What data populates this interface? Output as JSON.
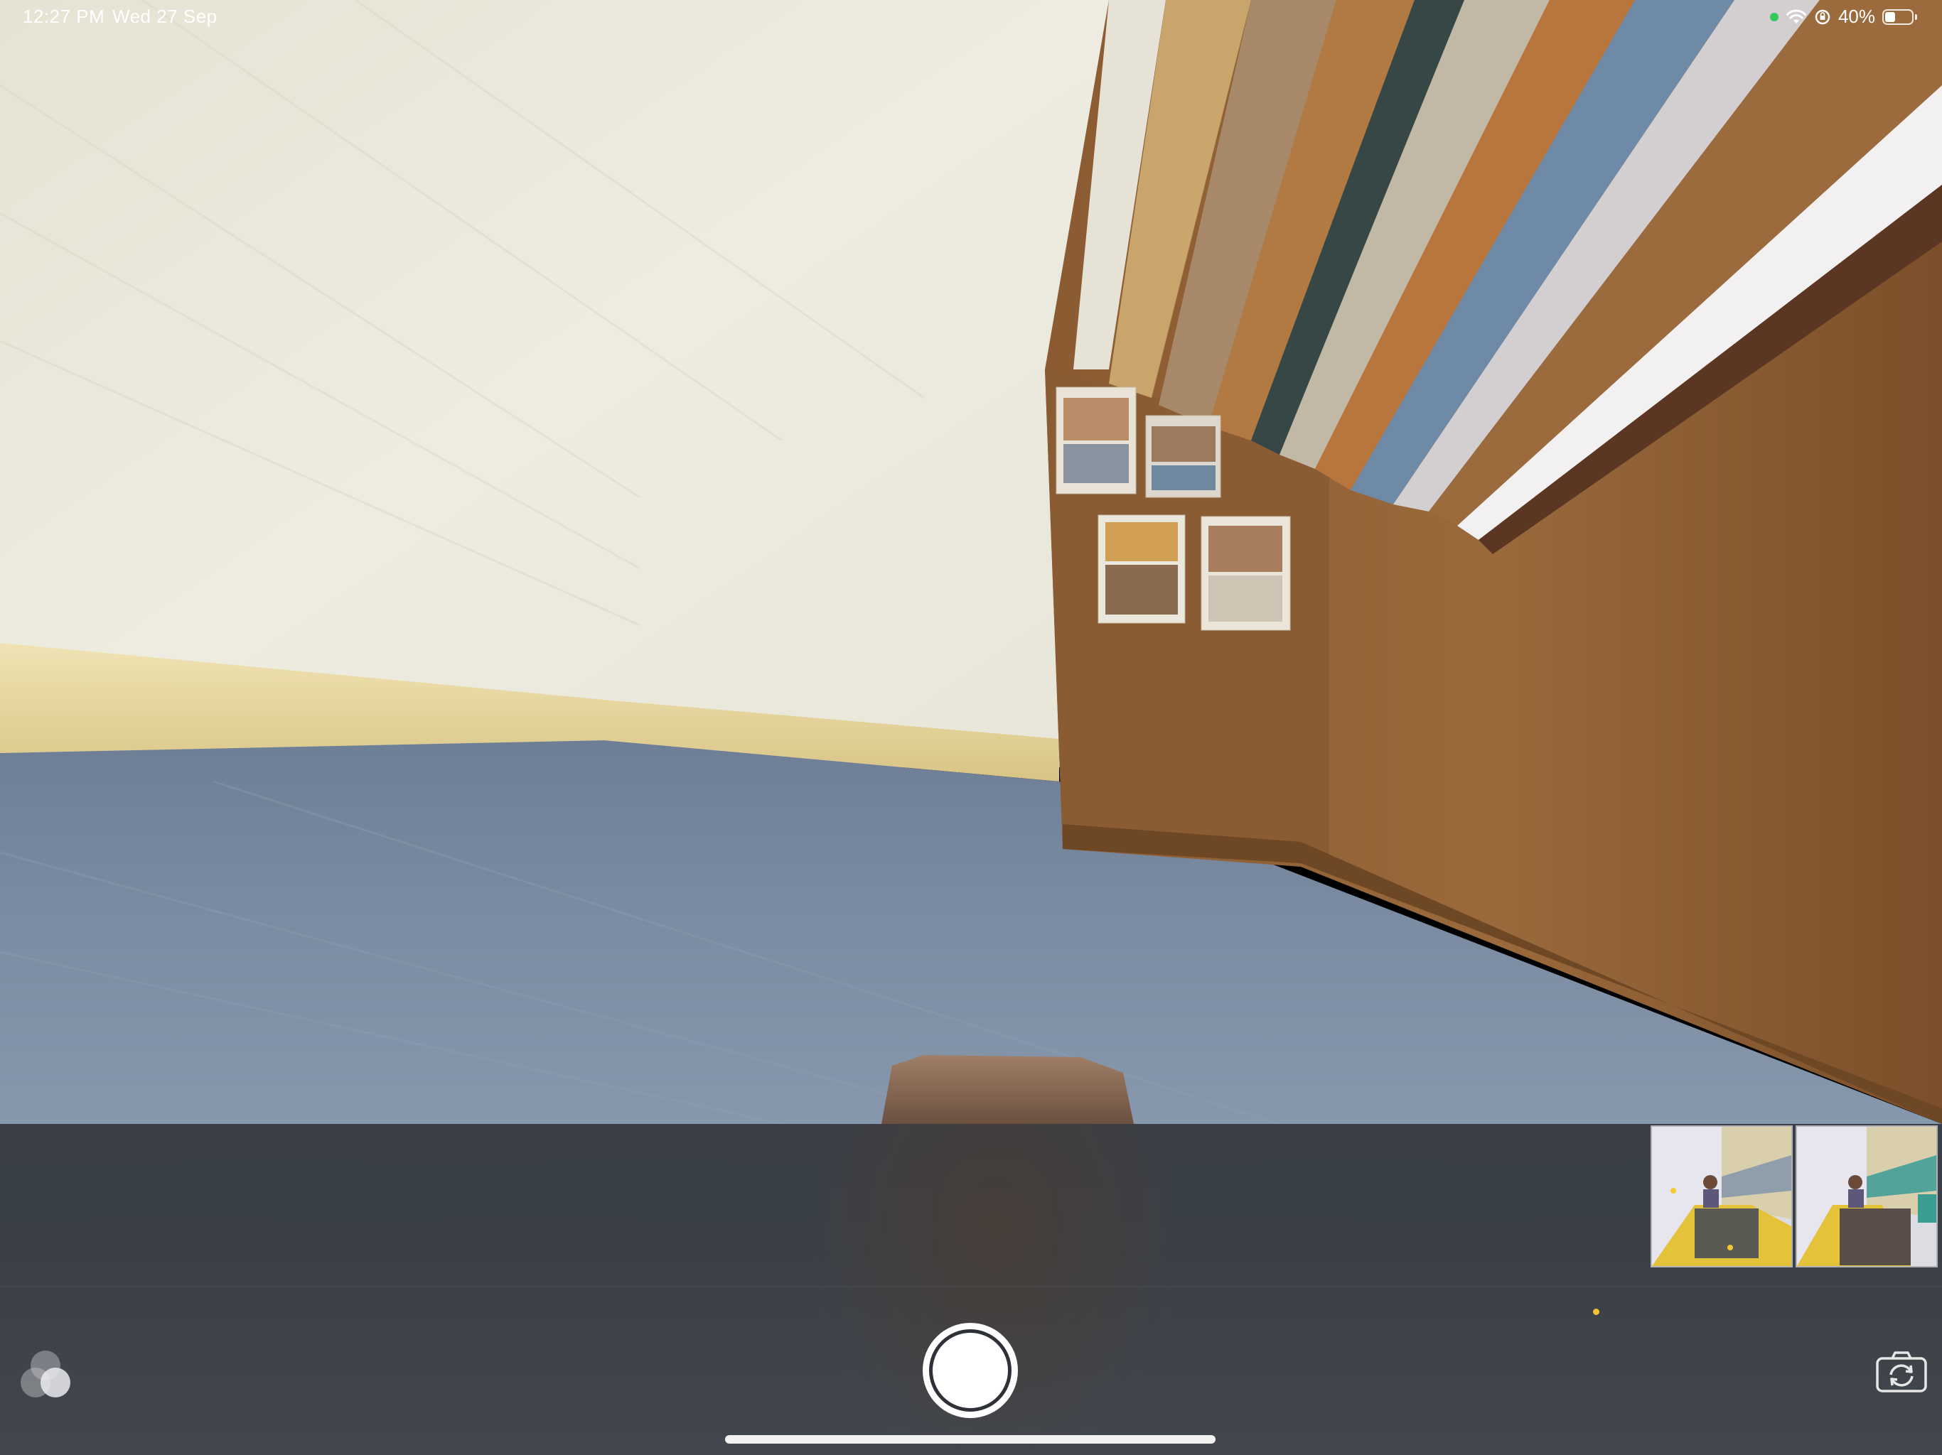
{
  "status_bar": {
    "time": "12:27 PM",
    "date": "Wed 27 Sep",
    "battery_percent_label": "40%",
    "battery_level": 0.4,
    "camera_in_use_color": "#34c759",
    "icons": [
      "wifi-icon",
      "orientation-lock-icon",
      "battery-icon"
    ]
  },
  "camera": {
    "mode": "photo",
    "viewfinder_scene": "room floor, wall and wooden cabinet with photos",
    "controls": {
      "filters_icon": "filters-icon",
      "shutter_icon": "shutter-icon",
      "flip_icon": "flip-camera-icon"
    },
    "thumbnails": [
      {
        "label": "captured-photo-1",
        "accent": "#f3c832"
      },
      {
        "label": "captured-photo-2",
        "accent": "#f3c832"
      }
    ],
    "indicator_color": "#f4c430"
  },
  "colors": {
    "wall": "#ebe8da",
    "floor": "#7c8da2",
    "cabinet": "#8c5e34",
    "control_bar": "#3a3f47"
  }
}
